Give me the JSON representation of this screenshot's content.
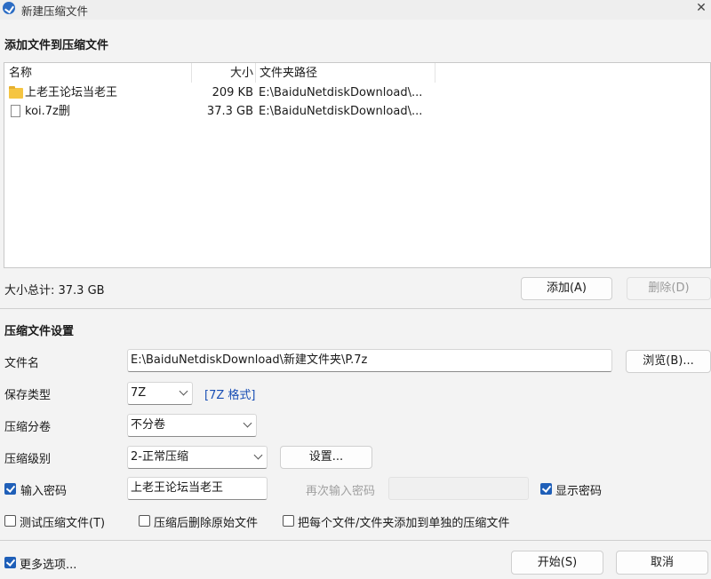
{
  "window": {
    "title": "新建压缩文件",
    "close_glyph": "✕"
  },
  "add_section": {
    "title": "添加文件到压缩文件"
  },
  "file_list": {
    "columns": {
      "name": "名称",
      "size": "大小",
      "path": "文件夹路径"
    },
    "rows": [
      {
        "icon": "folder-icon",
        "name": "上老王论坛当老王",
        "size": "209 KB",
        "path": "E:\\BaiduNetdiskDownload\\..."
      },
      {
        "icon": "file-icon",
        "name": "koi.7z删",
        "size": "37.3 GB",
        "path": "E:\\BaiduNetdiskDownload\\..."
      }
    ]
  },
  "total_size": "大小总计: 37.3 GB",
  "buttons": {
    "add": "添加(A)",
    "delete": "删除(D)",
    "browse": "浏览(B)...",
    "settings": "设置...",
    "start": "开始(S)",
    "cancel": "取消"
  },
  "settings_section": {
    "title": "压缩文件设置"
  },
  "filename": {
    "label": "文件名",
    "value": "E:\\BaiduNetdiskDownload\\新建文件夹\\P.7z"
  },
  "save_type": {
    "label": "保存类型",
    "value": "7Z",
    "format_link": "[7Z 格式]"
  },
  "split": {
    "label": "压缩分卷",
    "value": "不分卷"
  },
  "level": {
    "label": "压缩级别",
    "value": "2-正常压缩"
  },
  "password": {
    "label": "输入密码",
    "checked": true,
    "value": "上老王论坛当老王",
    "reenter_label": "再次输入密码",
    "reenter_value": "",
    "show_label": "显示密码",
    "show_checked": true
  },
  "options": {
    "test": {
      "label": "测试压缩文件(T)",
      "checked": false
    },
    "delete_after": {
      "label": "压缩后删除原始文件",
      "checked": false
    },
    "each_separate": {
      "label": "把每个文件/文件夹添加到单独的压缩文件",
      "checked": false
    },
    "more": {
      "label": "更多选项...",
      "checked": true
    }
  },
  "colors": {
    "accent": "#1f5fb8",
    "link": "#1a4fb5",
    "folder": "#f5c542"
  }
}
